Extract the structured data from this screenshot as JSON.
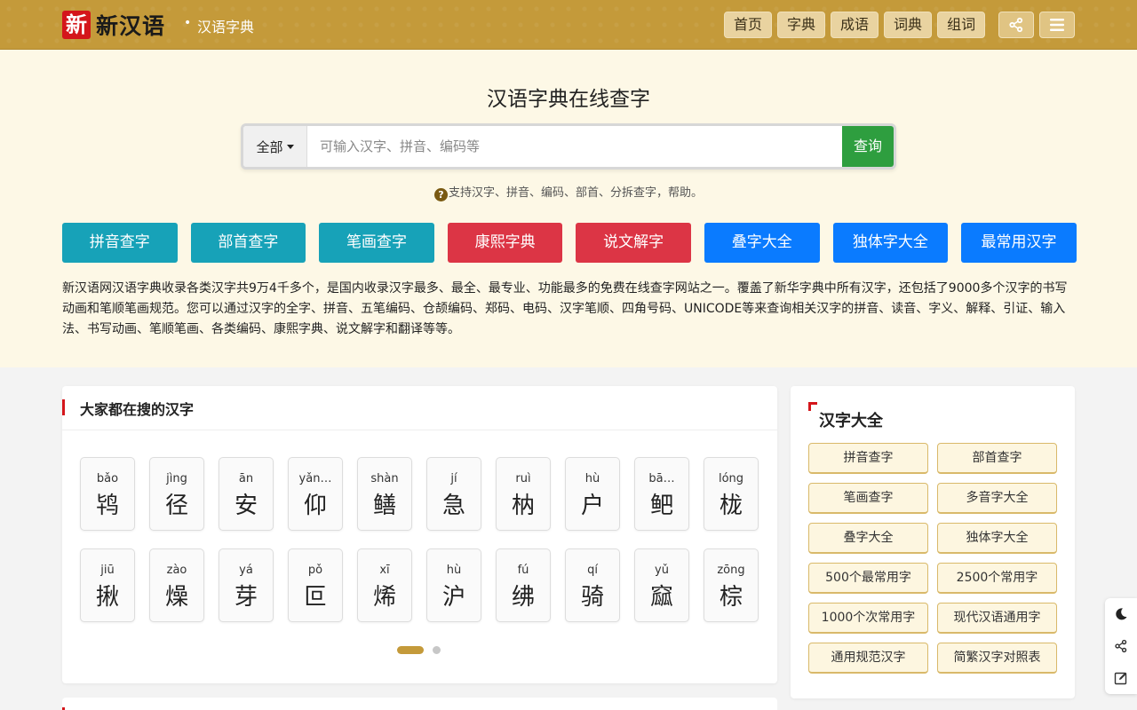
{
  "header": {
    "logo_seal": "新",
    "logo_text": "新汉语",
    "breadcrumb": "汉语字典",
    "nav": [
      "首页",
      "字典",
      "成语",
      "词典",
      "组词"
    ],
    "share_icon": "share-icon",
    "menu_icon": "menu-icon"
  },
  "hero": {
    "title": "汉语字典在线查字",
    "search": {
      "type_label": "全部",
      "placeholder": "可输入汉字、拼音、编码等",
      "button_label": "查询"
    },
    "help_text": "支持汉字、拼音、编码、部首、分拆查字，帮助。",
    "tiles": [
      {
        "label": "拼音查字",
        "color": "#17a2b8"
      },
      {
        "label": "部首查字",
        "color": "#17a2b8"
      },
      {
        "label": "笔画查字",
        "color": "#17a2b8"
      },
      {
        "label": "康熙字典",
        "color": "#dc3545"
      },
      {
        "label": "说文解字",
        "color": "#dc3545"
      },
      {
        "label": "叠字大全",
        "color": "#0a7bff"
      },
      {
        "label": "独体字大全",
        "color": "#0a7bff"
      },
      {
        "label": "最常用汉字",
        "color": "#0a7bff"
      }
    ],
    "intro": "新汉语网汉语字典收录各类汉字共9万4千多个，是国内收录汉字最多、最全、最专业、功能最多的免费在线查字网站之一。覆盖了新华字典中所有汉字，还包括了9000多个汉字的书写动画和笔顺笔画规范。您可以通过汉字的全字、拼音、五笔编码、仓颉编码、郑码、电码、汉字笔顺、四角号码、UNICODE等来查询相关汉字的拼音、读音、字义、解释、引证、输入法、书写动画、笔顺笔画、各类编码、康熙字典、说文解字和翻译等等。"
  },
  "hot": {
    "title": "大家都在搜的汉字",
    "chars": [
      {
        "py": "bǎo",
        "hz": "鸨"
      },
      {
        "py": "jìng",
        "hz": "径"
      },
      {
        "py": "ān",
        "hz": "安"
      },
      {
        "py": "yǎn…",
        "hz": "仰"
      },
      {
        "py": "shàn",
        "hz": "鳝"
      },
      {
        "py": "jí",
        "hz": "急"
      },
      {
        "py": "ruì",
        "hz": "枘"
      },
      {
        "py": "hù",
        "hz": "户"
      },
      {
        "py": "bā…",
        "hz": "鲃"
      },
      {
        "py": "lóng",
        "hz": "栊"
      },
      {
        "py": "jiū",
        "hz": "揪"
      },
      {
        "py": "zào",
        "hz": "燥"
      },
      {
        "py": "yá",
        "hz": "芽"
      },
      {
        "py": "pǒ",
        "hz": "叵"
      },
      {
        "py": "xī",
        "hz": "烯"
      },
      {
        "py": "hù",
        "hz": "沪"
      },
      {
        "py": "fú",
        "hz": "绋"
      },
      {
        "py": "qí",
        "hz": "骑"
      },
      {
        "py": "yǔ",
        "hz": "窳"
      },
      {
        "py": "zōng",
        "hz": "棕"
      }
    ],
    "pages": 2,
    "current_page": 1
  },
  "sidebar": {
    "title": "汉字大全",
    "links": [
      "拼音查字",
      "部首查字",
      "笔画查字",
      "多音字大全",
      "叠字大全",
      "独体字大全",
      "500个最常用字",
      "2500个常用字",
      "1000个次常用字",
      "现代汉语通用字",
      "通用规范汉字",
      "简繁汉字对照表"
    ]
  },
  "floating_tools": [
    "moon-icon",
    "share-icon",
    "edit-icon"
  ],
  "colors": {
    "gold": "#c49a3a",
    "cream": "#fdf8e6",
    "accent_red": "#d4161b",
    "search_green": "#2e9e3f"
  }
}
